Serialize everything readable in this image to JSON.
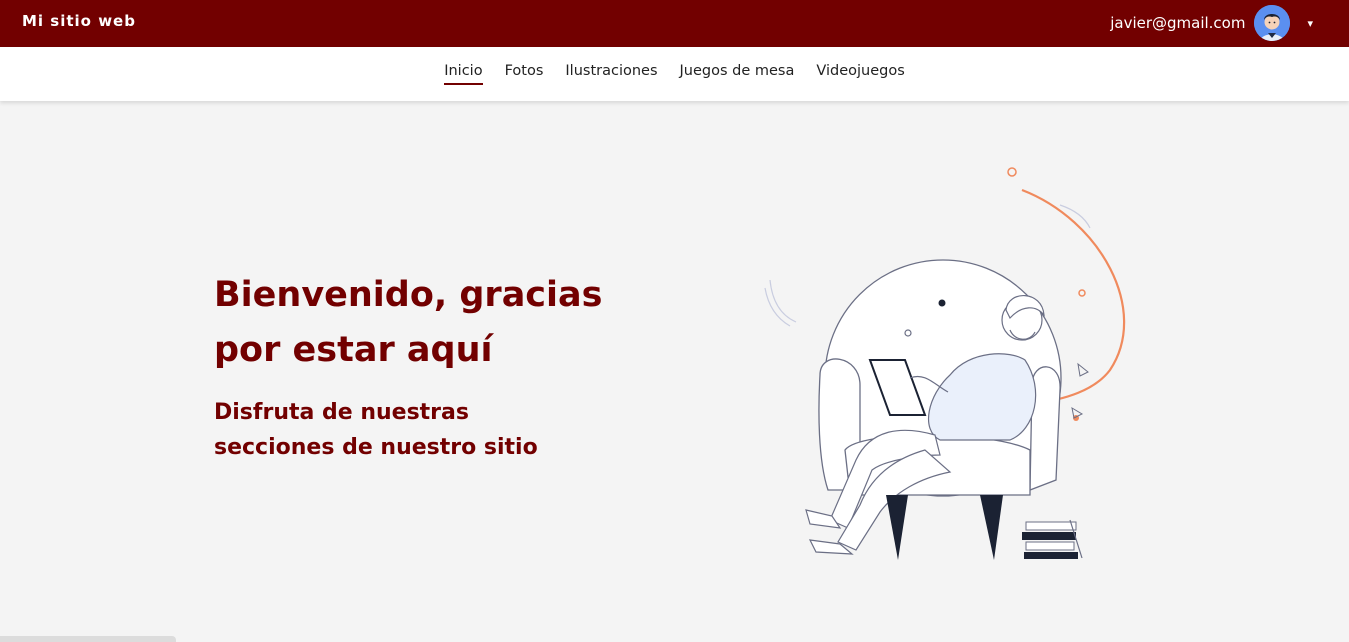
{
  "header": {
    "brand": "Mi sitio web",
    "user_email": "javier@gmail.com",
    "caret": "▾"
  },
  "nav": {
    "items": [
      {
        "label": "Inicio",
        "active": true
      },
      {
        "label": "Fotos",
        "active": false
      },
      {
        "label": "Ilustraciones",
        "active": false
      },
      {
        "label": "Juegos de mesa",
        "active": false
      },
      {
        "label": "Videojuegos",
        "active": false
      }
    ]
  },
  "hero": {
    "title": "Bienvenido, gracias por estar aquí",
    "subtitle": "Disfruta de nuestras secciones de nuestro sitio"
  },
  "colors": {
    "brand": "#720000",
    "accent": "#f08a5d",
    "avatar_bg": "#5b8ff0"
  }
}
